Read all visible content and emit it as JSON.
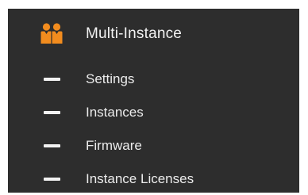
{
  "nav": {
    "section": {
      "title": "Multi-Instance",
      "icon": "people-group-icon",
      "icon_color": "#f28c1e"
    },
    "items": [
      {
        "label": "Settings",
        "icon": "dash-icon"
      },
      {
        "label": "Instances",
        "icon": "dash-icon"
      },
      {
        "label": "Firmware",
        "icon": "dash-icon"
      },
      {
        "label": "Instance Licenses",
        "icon": "dash-icon"
      }
    ],
    "colors": {
      "background": "#2d2d2d",
      "text": "#f2f2f2"
    }
  }
}
